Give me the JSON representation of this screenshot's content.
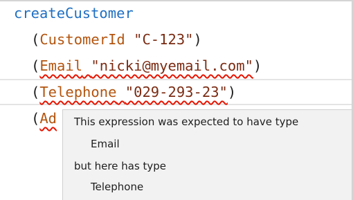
{
  "editor": {
    "lines": [
      {
        "fn": "createCustomer"
      },
      {
        "open": "(",
        "field": "CustomerId",
        "value": "\"C-123\"",
        "close": ")"
      },
      {
        "open": "(",
        "field": "Email",
        "value": "\"nicki@myemail.com\"",
        "close": ")"
      },
      {
        "open": "(",
        "field": "Telephone",
        "value": "\"029-293-23\"",
        "close": ")"
      },
      {
        "open": "(",
        "field": "Ad"
      }
    ],
    "error_color": "#e51400"
  },
  "tooltip": {
    "line1": "This expression was expected to have type",
    "expected_type": "Email",
    "line3": "but here has type",
    "actual_type": "Telephone"
  }
}
